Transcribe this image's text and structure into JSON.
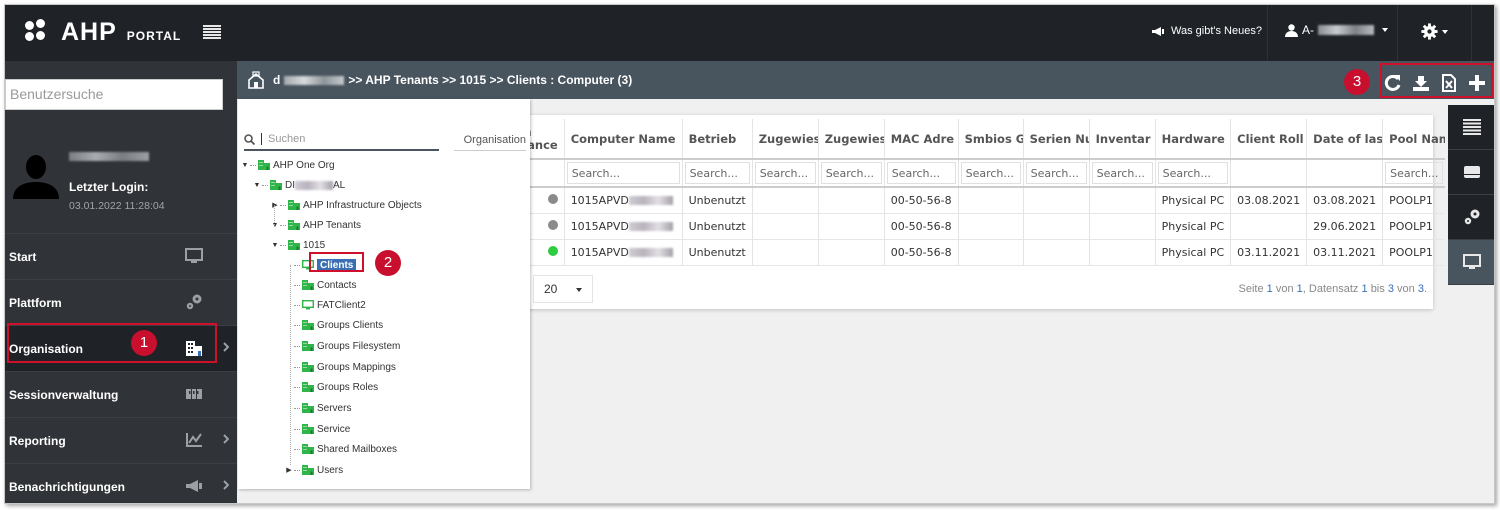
{
  "topbar": {
    "logo_text": "AHP",
    "logo_sub": "PORTAL",
    "news_label": "Was gibt's Neues?",
    "user_prefix": "A-"
  },
  "sidebar": {
    "search_placeholder": "Benutzersuche",
    "last_login_label": "Letzter Login:",
    "last_login_value": "03.01.2022 11:28:04",
    "items": [
      {
        "label": "Start",
        "icon": "monitor-icon",
        "has_submenu": false
      },
      {
        "label": "Plattform",
        "icon": "gears-icon",
        "has_submenu": false
      },
      {
        "label": "Organisation",
        "icon": "building-icon",
        "has_submenu": true,
        "active": true
      },
      {
        "label": "Sessionverwaltung",
        "icon": "sessions-icon",
        "has_submenu": false
      },
      {
        "label": "Reporting",
        "icon": "chart-icon",
        "has_submenu": true
      },
      {
        "label": "Benachrichtigungen",
        "icon": "megaphone-icon",
        "has_submenu": true
      }
    ]
  },
  "breadcrumb": {
    "prefix_blurred": "d",
    "path": ">> AHP Tenants >> 1015 >> Clients : Computer (3)"
  },
  "toolbar": {
    "icons": [
      "refresh-icon",
      "download-icon",
      "export-excel-icon",
      "add-icon"
    ]
  },
  "callouts": [
    "1",
    "2",
    "3"
  ],
  "tree_panel": {
    "search_placeholder": "Suchen",
    "tab_label": "Organisation",
    "nodes": [
      {
        "label": "AHP One Org",
        "level": 0,
        "toggle": "▼",
        "icon": "building-icon"
      },
      {
        "label": "DI",
        "suffix": "AL",
        "level": 1,
        "toggle": "▼",
        "icon": "building-icon"
      },
      {
        "label": "AHP Infrastructure Objects",
        "level": 2,
        "toggle": "▶",
        "icon": "building-icon"
      },
      {
        "label": "AHP Tenants",
        "level": 2,
        "toggle": "▼",
        "icon": "building-icon"
      },
      {
        "label": "1015",
        "level": 3,
        "toggle": "▼",
        "icon": "building-icon"
      },
      {
        "label": "Clients",
        "level": 4,
        "toggle": "",
        "icon": "monitor-icon",
        "selected": true
      },
      {
        "label": "Contacts",
        "level": 4,
        "toggle": "",
        "icon": "building-icon"
      },
      {
        "label": "FATClient2",
        "level": 4,
        "toggle": "",
        "icon": "monitor-icon"
      },
      {
        "label": "Groups Clients",
        "level": 4,
        "toggle": "",
        "icon": "building-icon"
      },
      {
        "label": "Groups Filesystem",
        "level": 4,
        "toggle": "",
        "icon": "building-icon"
      },
      {
        "label": "Groups Mappings",
        "level": 4,
        "toggle": "",
        "icon": "building-icon"
      },
      {
        "label": "Groups Roles",
        "level": 4,
        "toggle": "",
        "icon": "building-icon"
      },
      {
        "label": "Servers",
        "level": 4,
        "toggle": "",
        "icon": "building-icon"
      },
      {
        "label": "Service",
        "level": 4,
        "toggle": "",
        "icon": "building-icon"
      },
      {
        "label": "Shared Mailboxes",
        "level": 4,
        "toggle": "",
        "icon": "building-icon"
      },
      {
        "label": "Users",
        "level": 4,
        "toggle": "▶",
        "icon": "building-icon"
      }
    ]
  },
  "table": {
    "columns": [
      {
        "label": "tch\npliance",
        "searchable": false
      },
      {
        "label": "Computer Name",
        "searchable": true
      },
      {
        "label": "Betrieb",
        "searchable": true
      },
      {
        "label": "Zugewiese",
        "searchable": true
      },
      {
        "label": "Zugewiese",
        "searchable": true
      },
      {
        "label": "MAC Adre",
        "searchable": true
      },
      {
        "label": "Smbios GU",
        "searchable": true
      },
      {
        "label": "Serien Nu",
        "searchable": true
      },
      {
        "label": "Inventar N",
        "searchable": true
      },
      {
        "label": "Hardware",
        "searchable": true
      },
      {
        "label": "Client Roll",
        "searchable": false
      },
      {
        "label": "Date of las",
        "searchable": false
      },
      {
        "label": "Pool Name",
        "searchable": true
      }
    ],
    "search_placeholder": "Search...",
    "rows": [
      {
        "status": "gray",
        "name": "1015APVD",
        "betrieb": "Unbenutzt",
        "z1": "",
        "z2": "",
        "mac": "00-50-56-8",
        "smbios": "",
        "serien": "",
        "inventar": "",
        "hardware": "Physical PC",
        "client_roll": "03.08.2021",
        "date_last": "03.08.2021",
        "pool": "POOLP1"
      },
      {
        "status": "gray",
        "name": "1015APVD",
        "betrieb": "Unbenutzt",
        "z1": "",
        "z2": "",
        "mac": "00-50-56-8",
        "smbios": "",
        "serien": "",
        "inventar": "",
        "hardware": "Physical PC",
        "client_roll": "",
        "date_last": "29.06.2021",
        "pool": "POOLP1"
      },
      {
        "status": "green",
        "name": "1015APVD",
        "betrieb": "Unbenutzt",
        "z1": "",
        "z2": "",
        "mac": "00-50-56-8",
        "smbios": "",
        "serien": "",
        "inventar": "",
        "hardware": "Physical PC",
        "client_roll": "03.11.2021",
        "date_last": "03.11.2021",
        "pool": "POOLP1"
      }
    ],
    "page_size": "20",
    "pager": {
      "prefix": "Seite",
      "page": "1",
      "of": "von",
      "pages": "1",
      "mid": ", Datensatz",
      "from": "1",
      "to_word": "bis",
      "to": "3",
      "total_word": "von",
      "total": "3",
      "end": "."
    }
  },
  "right_strip": {
    "buttons": [
      "list-icon",
      "drive-icon",
      "gears-icon",
      "monitor-icon"
    ],
    "active_index": 3
  },
  "colors": {
    "accent_red": "#c8102e",
    "status_green": "#2ecc40",
    "status_gray": "#8a8a8a",
    "tree_green": "#2fb54a",
    "selected_blue": "#3a6fb5"
  }
}
